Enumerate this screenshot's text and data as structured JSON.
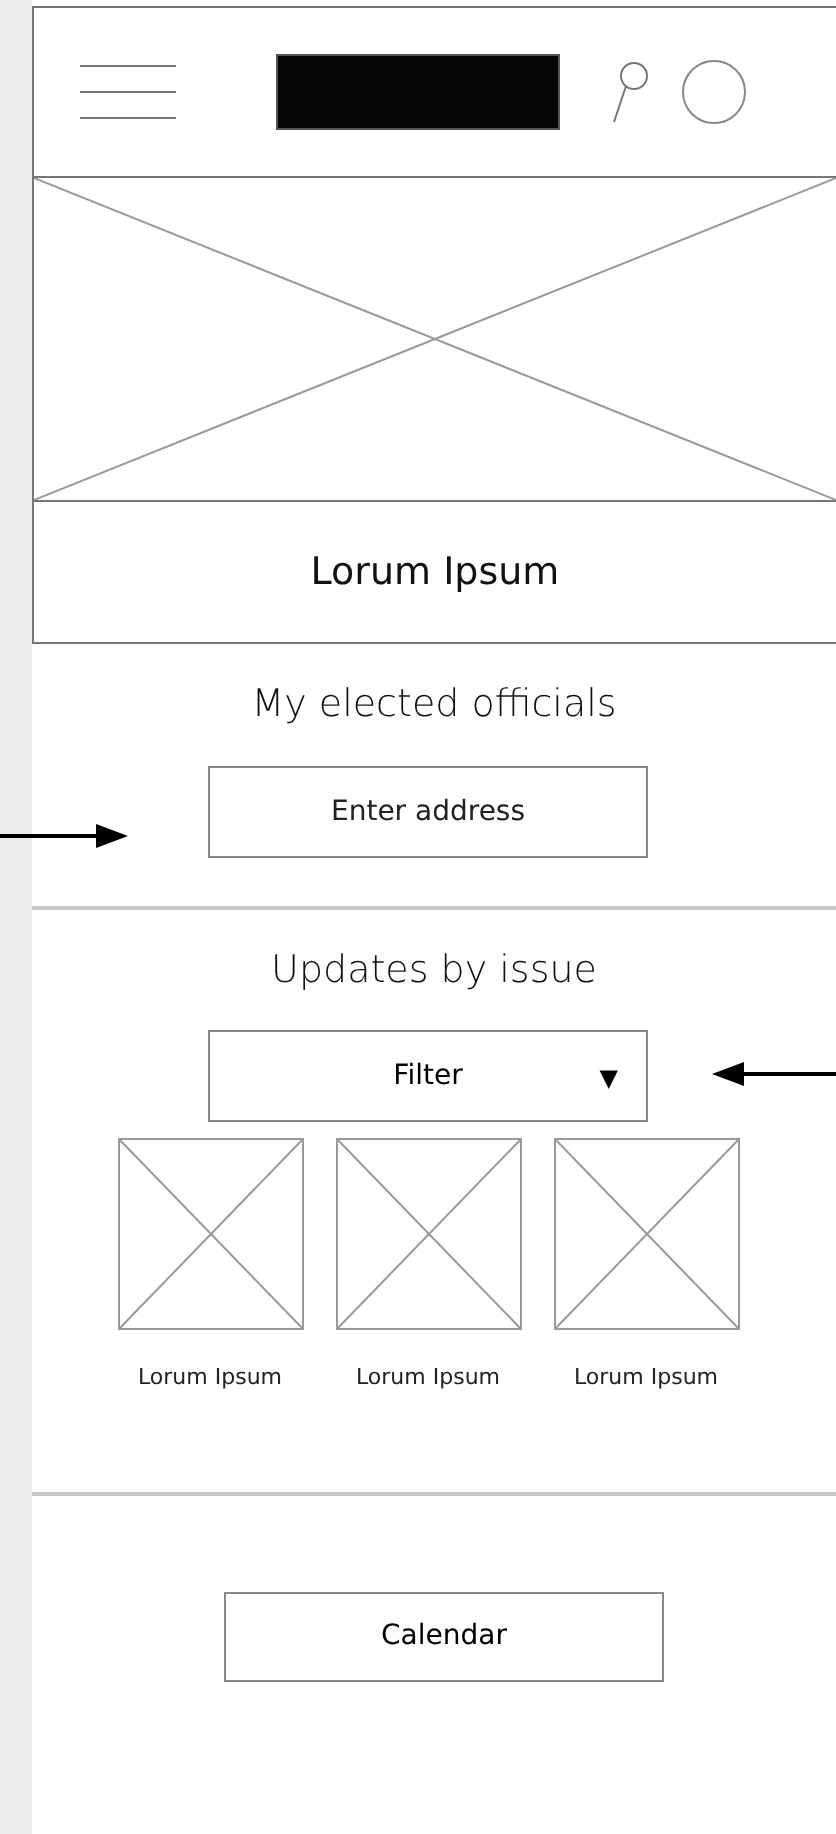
{
  "hero": {
    "caption": "Lorum Ipsum"
  },
  "officials": {
    "heading": "My elected officials",
    "address_field": {
      "placeholder": "Enter address"
    }
  },
  "updates": {
    "heading": "Updates by issue",
    "filter": {
      "label": "Filter",
      "caret": "▼"
    },
    "items": [
      {
        "caption": "Lorum Ipsum"
      },
      {
        "caption": "Lorum Ipsum"
      },
      {
        "caption": "Lorum Ipsum"
      }
    ]
  },
  "calendar_button": {
    "label": "Calendar"
  }
}
